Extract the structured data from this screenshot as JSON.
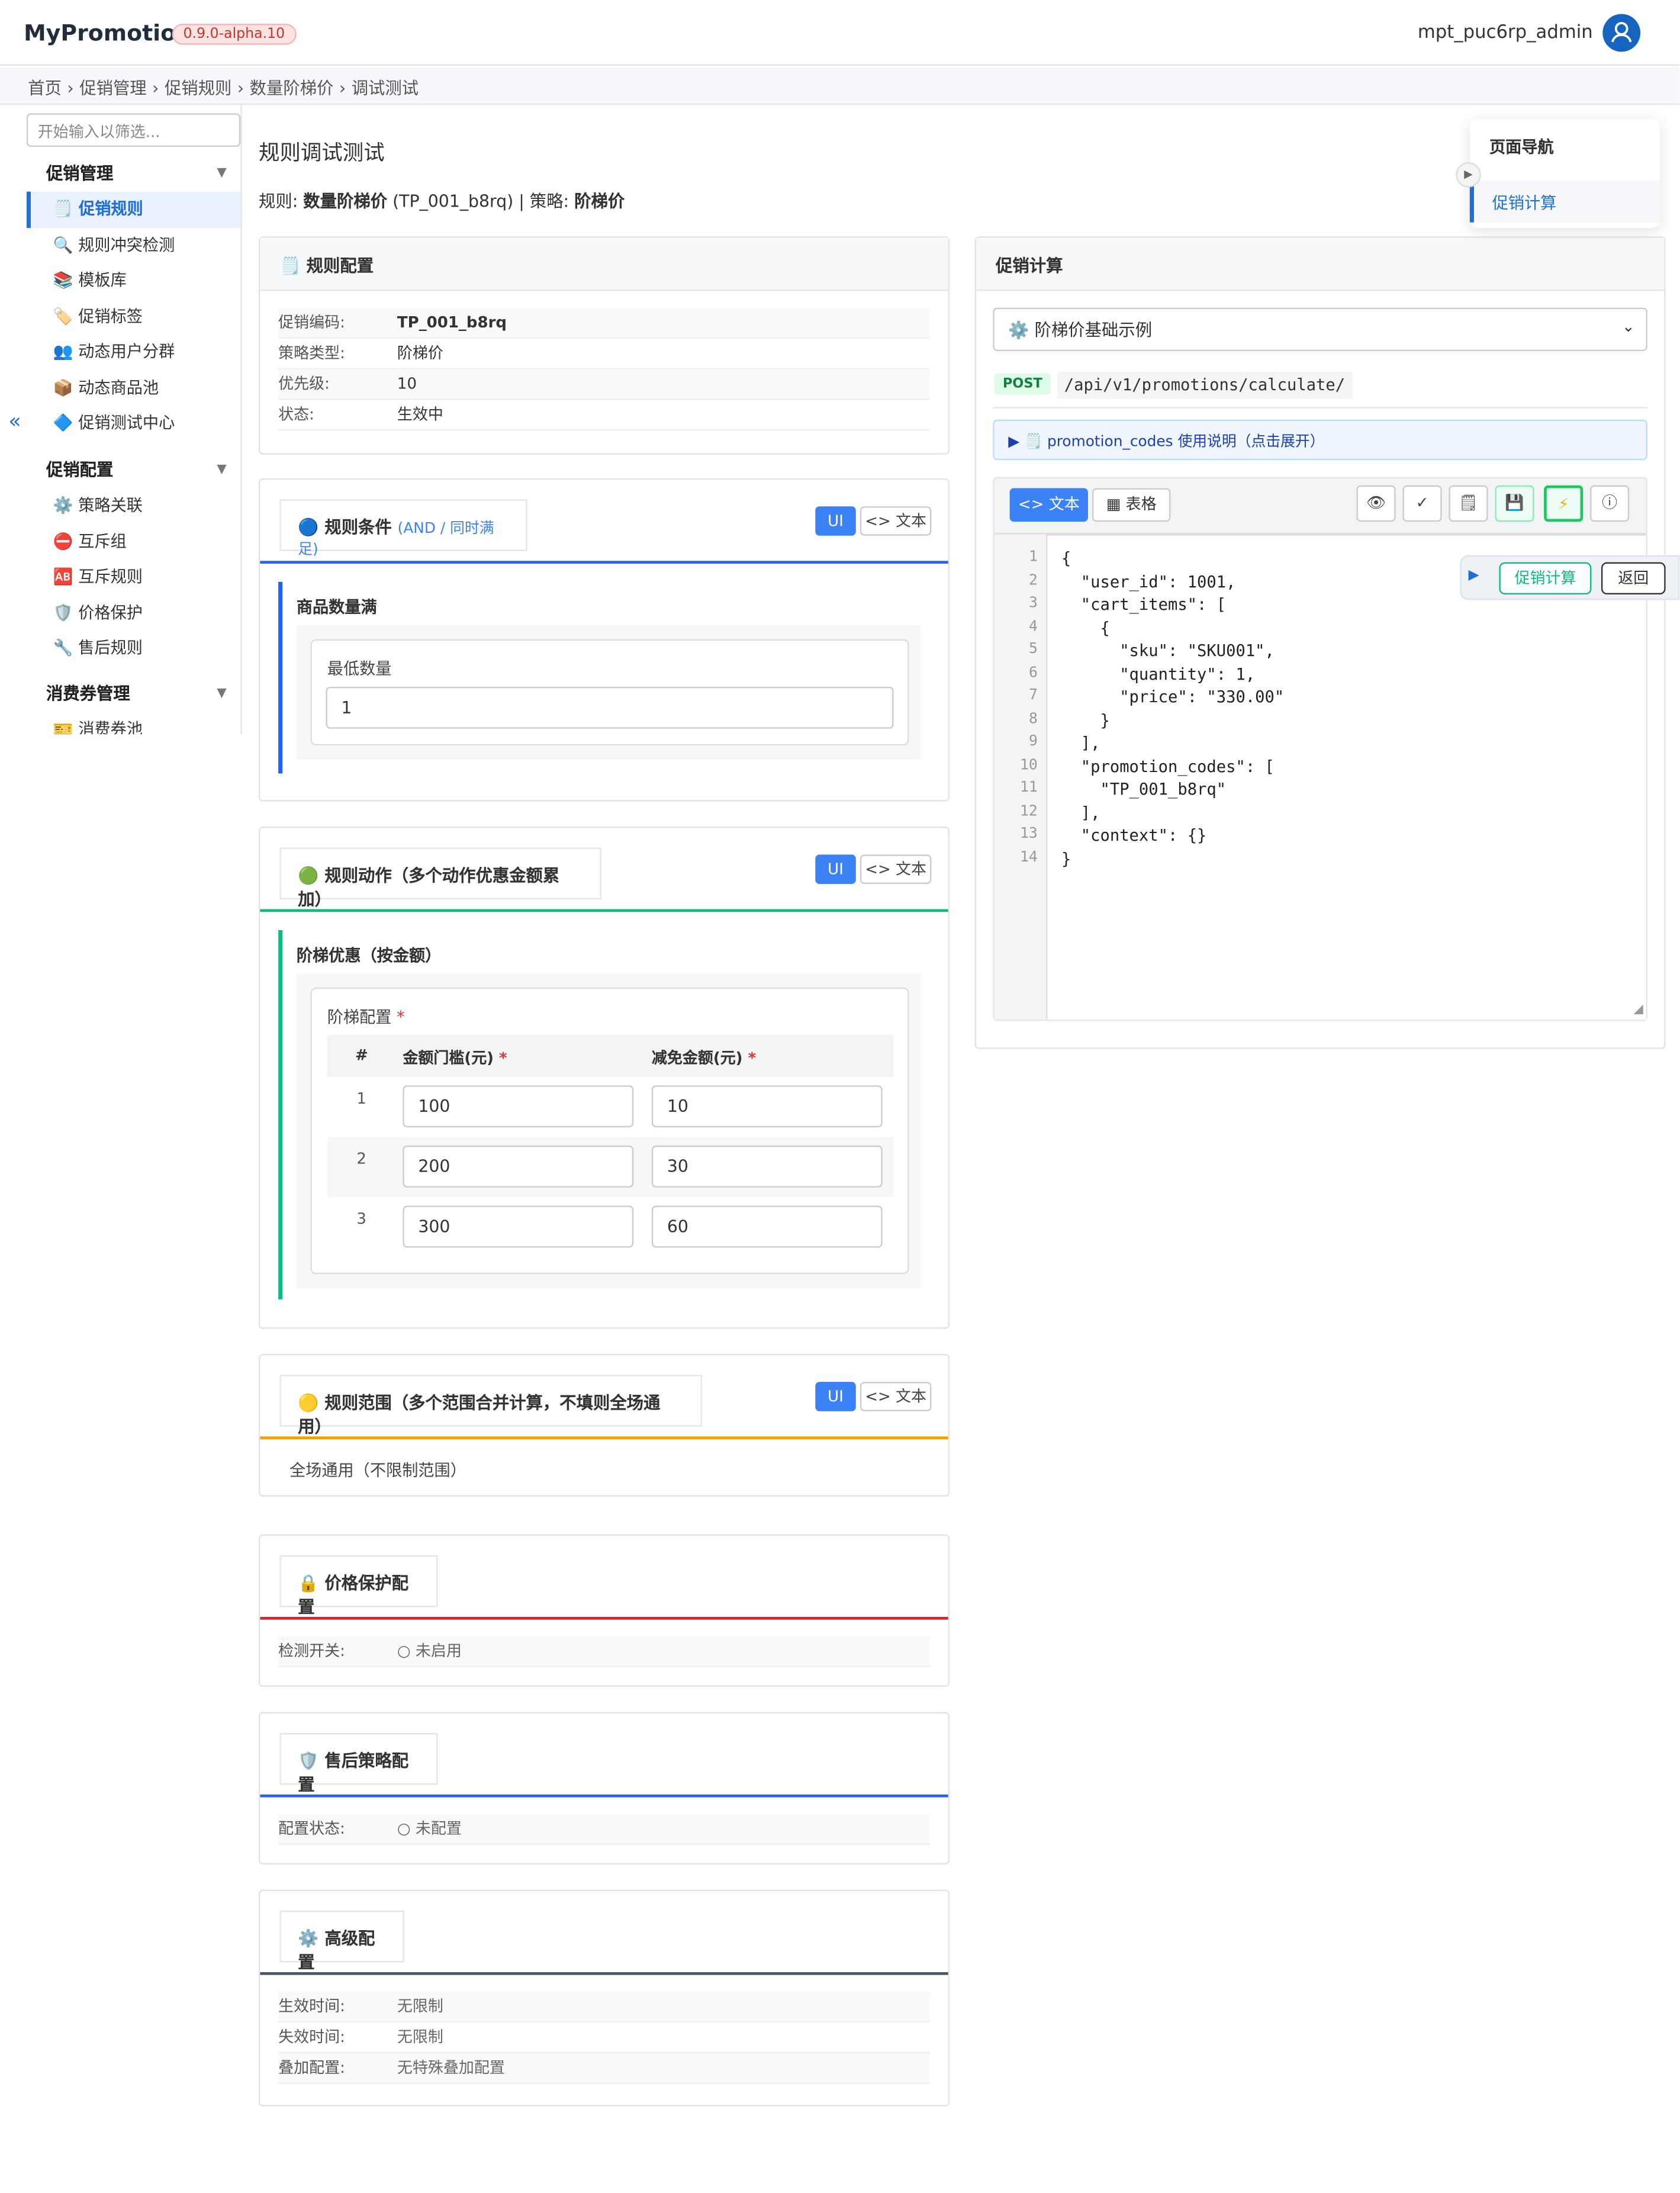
{
  "app": {
    "brand": "MyPromotion",
    "version": "0.9.0-alpha.10",
    "user": "mpt_puc6rp_admin"
  },
  "breadcrumb": [
    "首页",
    "›",
    "促销管理",
    "›",
    "促销规则",
    "›",
    "数量阶梯价",
    "›",
    "调试测试"
  ],
  "sidebar": {
    "filter_placeholder": "开始输入以筛选...",
    "collapse": "«",
    "groups": [
      {
        "label": "促销管理",
        "items": [
          "🗒️ 促销规则",
          "🔍 规则冲突检测",
          "📚 模板库",
          "🏷️ 促销标签",
          "👥 动态用户分群",
          "📦 动态商品池",
          "🔷 促销测试中心"
        ]
      },
      {
        "label": "促销配置",
        "items": [
          "⚙️ 策略关联",
          "⛔ 互斥组",
          "🆎 互斥规则",
          "🛡️ 价格保护",
          "🔧 售后规则"
        ]
      },
      {
        "label": "消费券管理",
        "items": [
          "🎫 消费券池"
        ]
      }
    ]
  },
  "page": {
    "title": "规则调试测试",
    "subtitle_prefix": "规则: ",
    "rule_name": "数量阶梯价",
    "rule_code": " (TP_001_b8rq) | 策略: ",
    "strategy": "阶梯价"
  },
  "rule_config": {
    "header": "🗒️ 规则配置",
    "rows": [
      [
        "促销编码:",
        "TP_001_b8rq"
      ],
      [
        "策略类型:",
        "阶梯价"
      ],
      [
        "优先级:",
        "10"
      ],
      [
        "状态:",
        "生效中"
      ]
    ]
  },
  "conditions": {
    "header": "🔵 规则条件",
    "tag": "(AND / 同时满足)",
    "ui": "UI",
    "text": "<> 文本",
    "item_title": "商品数量满",
    "field_label": "最低数量",
    "field_value": "1"
  },
  "actions": {
    "header": "🟢 规则动作（多个动作优惠金额累加）",
    "ui": "UI",
    "text": "<> 文本",
    "item_title": "阶梯优惠（按金额）",
    "table_label": "阶梯配置",
    "cols": [
      "#",
      "金额门槛(元)",
      "减免金额(元)"
    ],
    "rows": [
      [
        "1",
        "100",
        "10"
      ],
      [
        "2",
        "200",
        "30"
      ],
      [
        "3",
        "300",
        "60"
      ]
    ]
  },
  "scope": {
    "header": "🟡 规则范围（多个范围合并计算，不填则全场通用）",
    "ui": "UI",
    "text": "<> 文本",
    "value": "全场通用（不限制范围）"
  },
  "price_protect": {
    "header": "🔒 价格保护配置",
    "label": "检测开关:",
    "value": "○ 未启用"
  },
  "after_sale": {
    "header": "🛡️ 售后策略配置",
    "label": "配置状态:",
    "value": "○ 未配置"
  },
  "advanced": {
    "header": "⚙️ 高级配置",
    "rows": [
      [
        "生效时间:",
        "无限制"
      ],
      [
        "失效时间:",
        "无限制"
      ],
      [
        "叠加配置:",
        "无特殊叠加配置"
      ]
    ]
  },
  "calc": {
    "header": "促销计算",
    "example": "⚙️ 阶梯价基础示例",
    "method": "POST",
    "endpoint": "/api/v1/promotions/calculate/",
    "hint": "▶ 🗒️ promotion_codes 使用说明（点击展开）",
    "tab_text": "<> 文本",
    "tab_table": "▦ 表格",
    "tools": [
      "👁",
      "✓",
      "🗒",
      "💾",
      "⚡",
      "ⓘ"
    ],
    "code": [
      "{",
      "  \"user_id\": 1001,",
      "  \"cart_items\": [",
      "    {",
      "      \"sku\": \"SKU001\",",
      "      \"quantity\": 1,",
      "      \"price\": \"330.00\"",
      "    }",
      "  ],",
      "  \"promotion_codes\": [",
      "    \"TP_001_b8rq\"",
      "  ],",
      "  \"context\": {}",
      "}"
    ],
    "lines": [
      "1",
      "2",
      "3",
      "4",
      "5",
      "6",
      "7",
      "8",
      "9",
      "10",
      "11",
      "12",
      "13",
      "14"
    ],
    "float_calc": "促销计算",
    "float_back": "返回"
  },
  "page_nav": {
    "title": "页面导航",
    "item": "促销计算"
  }
}
